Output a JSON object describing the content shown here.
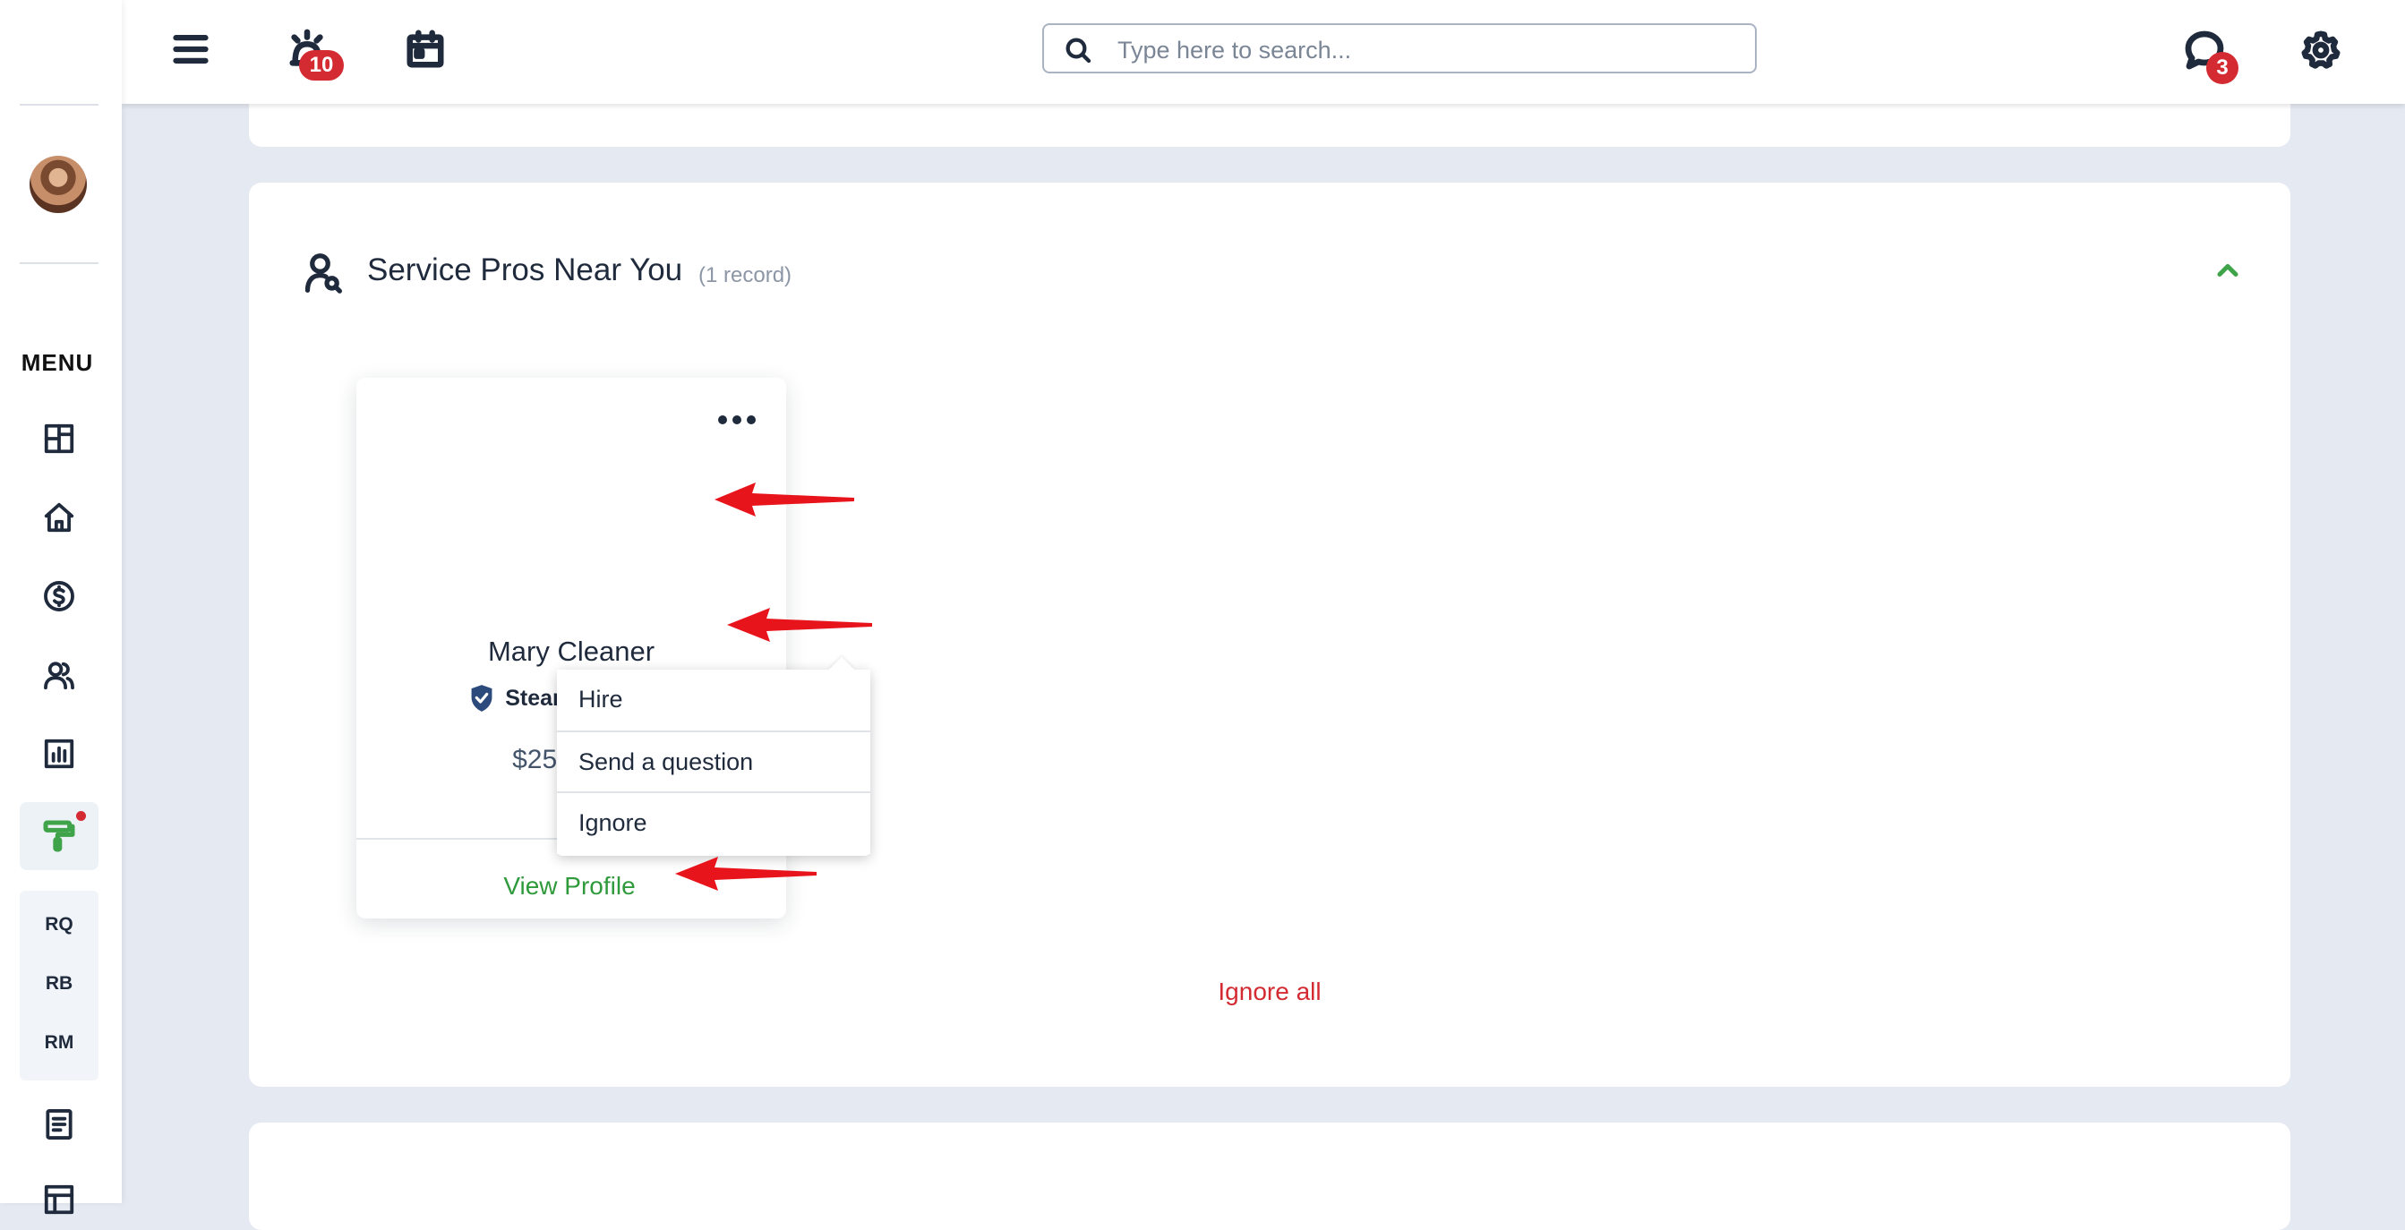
{
  "topbar": {
    "alarm_badge": "10",
    "messages_badge": "3",
    "search": {
      "placeholder": "Type here to search..."
    }
  },
  "sidebar": {
    "menu_label": "MENU",
    "sub_items": [
      "RQ",
      "RB",
      "RM"
    ]
  },
  "panel": {
    "title": "Service Pros Near You",
    "count": "(1 record)",
    "ignore_all": "Ignore all"
  },
  "pro_card": {
    "name": "Mary Cleaner",
    "skill": "Steam Cleaning",
    "price": "$250/total",
    "view_profile": "View Profile"
  },
  "dropdown": {
    "items": [
      "Hire",
      "Send a question",
      "Ignore"
    ]
  },
  "colors": {
    "accent_green": "#3fa34a",
    "badge_red": "#d42a32",
    "annotation_arrow_red": "#e8141c",
    "background": "#e5e9f1"
  },
  "icons": [
    "hamburger-icon",
    "alarm-icon",
    "calendar-icon",
    "search-icon",
    "chat-icon",
    "gear-icon",
    "dashboard-icon",
    "home-icon",
    "dollar-icon",
    "users-icon",
    "chart-icon",
    "paint-roller-icon",
    "document-icon",
    "building-icon",
    "person-search-icon",
    "chevron-up-icon",
    "shield-check-icon",
    "more-dots-icon"
  ]
}
